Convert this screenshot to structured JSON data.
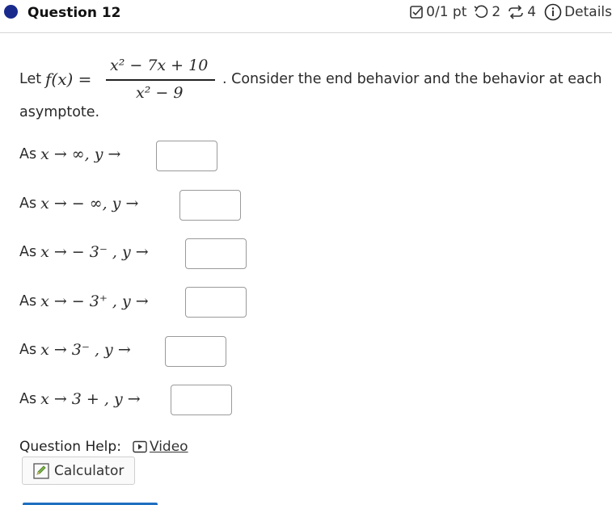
{
  "header": {
    "question_title": "Question 12",
    "score": "0/1 pt",
    "retries": "2",
    "attempts": "4",
    "details": "Details"
  },
  "problem": {
    "let": "Let",
    "function_lhs": "f(x) =",
    "numerator": "x² − 7x + 10",
    "denominator": "x² − 9",
    "after_fraction": ". Consider the end behavior and the behavior at each",
    "continuation": "asymptote."
  },
  "rows": [
    {
      "as": "As",
      "math": "x → ∞, y →",
      "answer": ""
    },
    {
      "as": "As",
      "math": "x →  − ∞, y →",
      "answer": ""
    },
    {
      "as": "As",
      "math": "x →  − 3⁻ , y →",
      "answer": ""
    },
    {
      "as": "As",
      "math": "x →  − 3⁺ , y →",
      "answer": ""
    },
    {
      "as": "As",
      "math": "x → 3⁻ , y →",
      "answer": ""
    },
    {
      "as": "As",
      "math": "x → 3 + , y →",
      "answer": ""
    }
  ],
  "help": {
    "label": "Question Help:",
    "video": "Video",
    "calculator": "Calculator"
  },
  "colors": {
    "accent": "#1a2a8c",
    "link_bar": "#1f6fbf"
  },
  "icons": {
    "score": "checkbox-icon",
    "retries": "undo-icon",
    "attempts": "repeat-icon",
    "details": "info-icon",
    "video": "play-icon",
    "calculator": "pencil-icon"
  }
}
